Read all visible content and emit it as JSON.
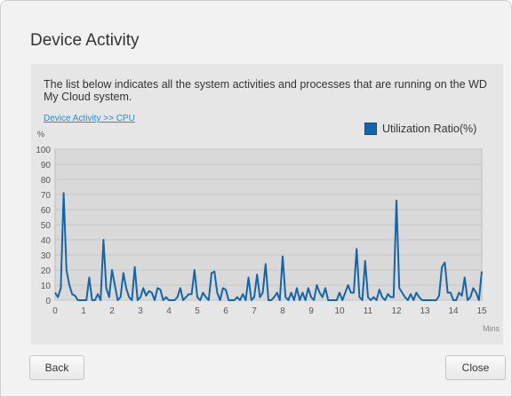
{
  "dialog": {
    "title": "Device Activity",
    "description": "The list below indicates all the system activities and processes that are running on the WD My Cloud system.",
    "link": "Device Activity >> CPU",
    "back_label": "Back",
    "close_label": "Close"
  },
  "colors": {
    "series": "#1565a8",
    "plot_background": "#d9d9d9",
    "link": "#1a8fd6"
  },
  "chart_data": {
    "type": "line",
    "ylabel": "%",
    "xlabel": "Mins",
    "ylim": [
      0,
      100
    ],
    "xlim": [
      0,
      15
    ],
    "yticks": [
      0,
      10,
      20,
      30,
      40,
      50,
      60,
      70,
      80,
      90,
      100
    ],
    "xticks": [
      0,
      1,
      2,
      3,
      4,
      5,
      6,
      7,
      8,
      9,
      10,
      11,
      12,
      13,
      14,
      15
    ],
    "grid": "horizontal",
    "legend_position": "top-right",
    "series": [
      {
        "name": "Utilization Ratio(%)",
        "x": [
          0,
          0.1,
          0.2,
          0.3,
          0.4,
          0.5,
          0.6,
          0.7,
          0.8,
          0.9,
          1.0,
          1.1,
          1.2,
          1.3,
          1.4,
          1.5,
          1.6,
          1.7,
          1.8,
          1.9,
          2.0,
          2.1,
          2.2,
          2.3,
          2.4,
          2.5,
          2.6,
          2.7,
          2.8,
          2.9,
          3.0,
          3.1,
          3.2,
          3.3,
          3.4,
          3.5,
          3.6,
          3.7,
          3.8,
          3.9,
          4.0,
          4.1,
          4.2,
          4.3,
          4.4,
          4.5,
          4.6,
          4.7,
          4.8,
          4.9,
          5.0,
          5.1,
          5.2,
          5.3,
          5.4,
          5.5,
          5.6,
          5.7,
          5.8,
          5.9,
          6.0,
          6.1,
          6.2,
          6.3,
          6.4,
          6.5,
          6.6,
          6.7,
          6.8,
          6.9,
          7.0,
          7.1,
          7.2,
          7.3,
          7.4,
          7.5,
          7.6,
          7.7,
          7.8,
          7.9,
          8.0,
          8.1,
          8.2,
          8.3,
          8.4,
          8.5,
          8.6,
          8.7,
          8.8,
          8.9,
          9.0,
          9.1,
          9.2,
          9.3,
          9.4,
          9.5,
          9.6,
          9.7,
          9.8,
          9.9,
          10.0,
          10.1,
          10.2,
          10.3,
          10.4,
          10.5,
          10.6,
          10.7,
          10.8,
          10.9,
          11.0,
          11.1,
          11.2,
          11.3,
          11.4,
          11.5,
          11.6,
          11.7,
          11.8,
          11.9,
          12.0,
          12.1,
          12.2,
          12.3,
          12.4,
          12.5,
          12.6,
          12.7,
          12.8,
          12.9,
          13.0,
          13.1,
          13.2,
          13.3,
          13.4,
          13.5,
          13.6,
          13.7,
          13.8,
          13.9,
          14.0,
          14.1,
          14.2,
          14.3,
          14.4,
          14.5,
          14.6,
          14.7,
          14.8,
          14.9,
          15.0
        ],
        "values": [
          5,
          2,
          8,
          71,
          20,
          10,
          4,
          3,
          0,
          0,
          0,
          0,
          15,
          0,
          0,
          4,
          0,
          40,
          8,
          2,
          20,
          10,
          0,
          2,
          18,
          8,
          2,
          0,
          22,
          0,
          2,
          8,
          3,
          6,
          5,
          0,
          8,
          7,
          0,
          2,
          0,
          0,
          0,
          2,
          8,
          0,
          2,
          4,
          4,
          20,
          2,
          0,
          5,
          2,
          0,
          18,
          19,
          5,
          0,
          8,
          7,
          0,
          0,
          0,
          2,
          0,
          4,
          0,
          15,
          0,
          2,
          17,
          2,
          5,
          24,
          0,
          0,
          2,
          5,
          0,
          29,
          2,
          0,
          5,
          0,
          8,
          0,
          5,
          0,
          8,
          2,
          0,
          10,
          5,
          2,
          8,
          0,
          0,
          0,
          0,
          5,
          0,
          5,
          10,
          5,
          5,
          34,
          2,
          0,
          26,
          2,
          0,
          2,
          0,
          7,
          2,
          0,
          4,
          2,
          2,
          66,
          8,
          5,
          2,
          0,
          4,
          0,
          5,
          2,
          0,
          0,
          0,
          0,
          0,
          0,
          3,
          22,
          25,
          5,
          5,
          0,
          0,
          5,
          3,
          15,
          0,
          2,
          8,
          5,
          0,
          19
        ]
      }
    ]
  }
}
